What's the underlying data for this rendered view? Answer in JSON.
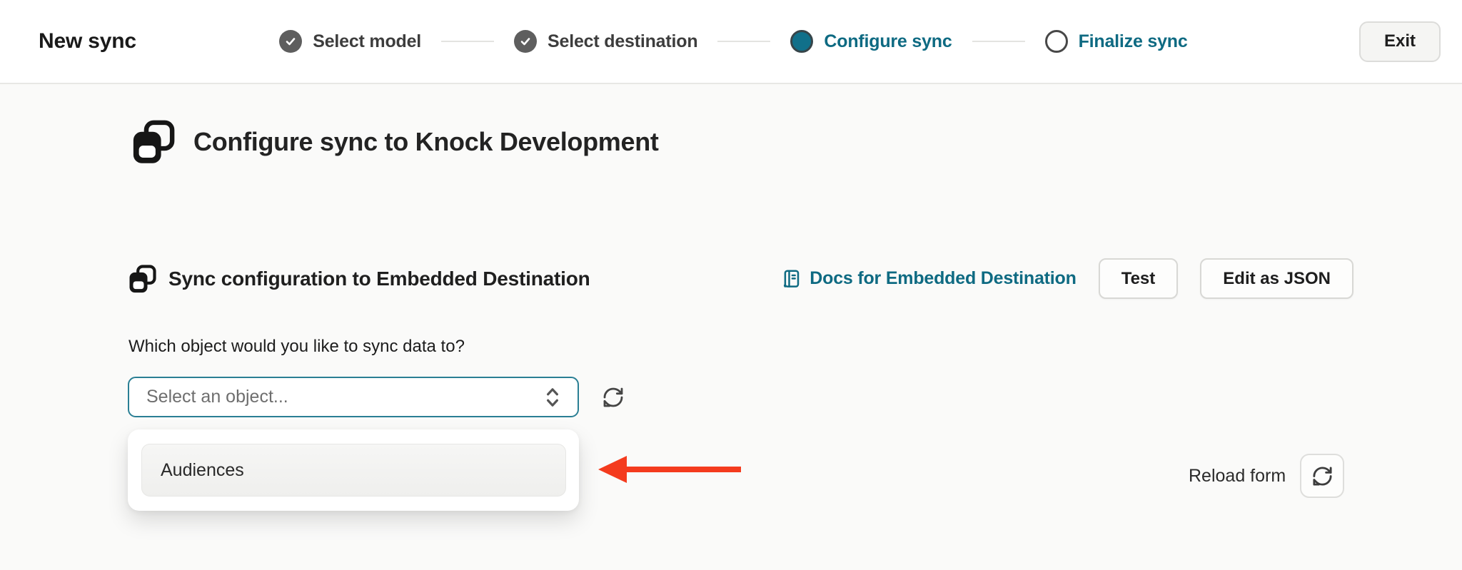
{
  "header": {
    "title": "New sync",
    "steps": [
      {
        "label": "Select model",
        "state": "complete"
      },
      {
        "label": "Select destination",
        "state": "complete"
      },
      {
        "label": "Configure sync",
        "state": "active"
      },
      {
        "label": "Finalize sync",
        "state": "upcoming"
      }
    ],
    "exit_label": "Exit"
  },
  "main": {
    "page_heading": "Configure sync to Knock Development",
    "section_header": {
      "title": "Sync configuration to Embedded Destination",
      "docs_link_label": "Docs for Embedded Destination",
      "test_button_label": "Test",
      "edit_json_button_label": "Edit as JSON"
    },
    "form": {
      "object_question_label": "Which object would you like to sync data to?",
      "object_select_placeholder": "Select an object...",
      "dropdown_options": [
        "Audiences"
      ]
    },
    "reload_form_label": "Reload form"
  },
  "icons": {
    "step_complete": "check-circle-icon",
    "heading": "sync-icon",
    "section": "sync-icon",
    "docs_link": "book-icon",
    "select": "chevron-up-down-icon",
    "refresh": "refresh-icon",
    "annotation": "red-arrow-left-icon"
  },
  "colors": {
    "accent_teal": "#0e6a82",
    "annotation_arrow_red": "#f43b1e",
    "step_complete_gray": "#5e5e5e",
    "active_step_fill": "#11708a",
    "select_focus_border": "#2a7f94",
    "page_background": "#fafaf9",
    "header_background": "#ffffff"
  }
}
